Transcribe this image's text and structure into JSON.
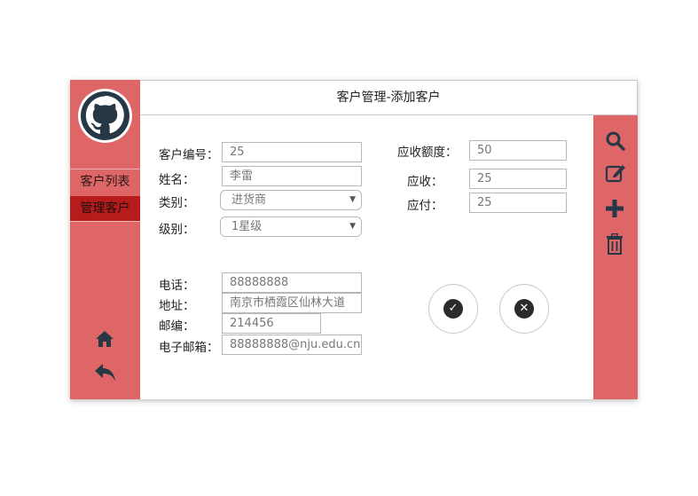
{
  "colors": {
    "accent": "#de6667",
    "active_nav": "#b71c1c",
    "icon": "#263746"
  },
  "header": {
    "title": "客户管理-添加客户"
  },
  "sidebar": {
    "items": [
      {
        "label": "客户列表",
        "active": false
      },
      {
        "label": "管理客户",
        "active": true
      }
    ],
    "bottom_icons": [
      "home-icon",
      "back-icon"
    ]
  },
  "toolbar": {
    "icons": [
      "search-icon",
      "edit-icon",
      "add-icon",
      "delete-icon"
    ]
  },
  "form": {
    "customer_id": {
      "label": "客户编号：",
      "value": "25"
    },
    "name": {
      "label": "姓名：",
      "value": "李雷"
    },
    "category": {
      "label": "类别：",
      "value": "进货商"
    },
    "level": {
      "label": "级别：",
      "value": "1星级"
    },
    "receivable_limit": {
      "label": "应收额度：",
      "value": "50"
    },
    "receivable": {
      "label": "应收：",
      "value": "25"
    },
    "payable": {
      "label": "应付：",
      "value": "25"
    },
    "phone": {
      "label": "电话：",
      "value": "88888888"
    },
    "address": {
      "label": "地址：",
      "value": "南京市栖霞区仙林大道"
    },
    "postcode": {
      "label": "邮编：",
      "value": "214456"
    },
    "email": {
      "label": "电子邮箱：",
      "value": "88888888@nju.edu.cn"
    }
  },
  "actions": {
    "confirm_icon": "check-icon",
    "cancel_icon": "close-icon"
  }
}
